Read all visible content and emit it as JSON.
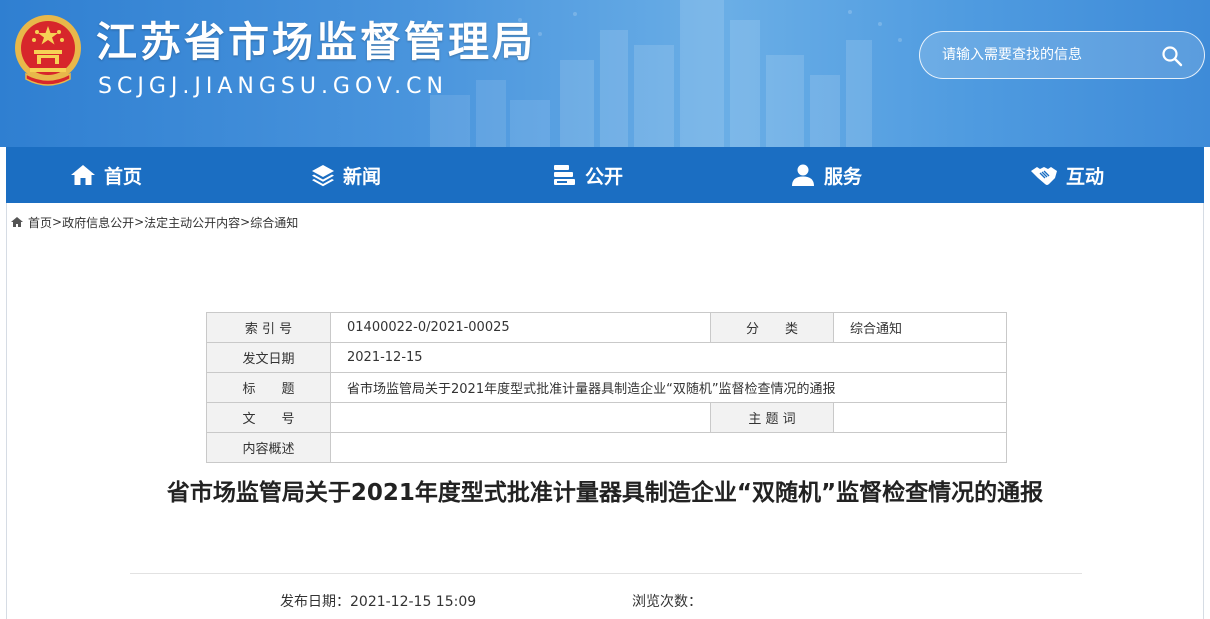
{
  "header": {
    "site_title": "江苏省市场监督管理局",
    "site_domain": "SCJGJ.JIANGSU.GOV.CN",
    "search_placeholder": "请输入需要查找的信息"
  },
  "nav": {
    "items": [
      {
        "label": "首页",
        "icon": "home-icon"
      },
      {
        "label": "新闻",
        "icon": "layers-icon"
      },
      {
        "label": "公开",
        "icon": "files-icon"
      },
      {
        "label": "服务",
        "icon": "user-icon"
      },
      {
        "label": "互动",
        "icon": "handshake-icon"
      }
    ]
  },
  "breadcrumb": {
    "items": [
      "首页",
      "政府信息公开",
      "法定主动公开内容",
      "综合通知"
    ],
    "separator": ">"
  },
  "info": {
    "index_label": "索 引 号",
    "index_value": "01400022-0/2021-00025",
    "category_label": "分　　类",
    "category_value": "综合通知",
    "date_label": "发文日期",
    "date_value": "2021-12-15",
    "title_label": "标　　题",
    "title_value": "省市场监管局关于2021年度型式批准计量器具制造企业“双随机”监督检查情况的通报",
    "docno_label": "文　　号",
    "docno_value": "",
    "subject_label": "主 题 词",
    "subject_value": "",
    "summary_label": "内容概述",
    "summary_value": ""
  },
  "article": {
    "title": "省市场监管局关于2021年度型式批准计量器具制造企业“双随机”监督检查情况的通报",
    "publish_label": "发布日期：",
    "publish_value": "2021-12-15 15:09",
    "views_label": "浏览次数："
  },
  "colors": {
    "header_blue": "#3e8bd8",
    "nav_blue": "#1b6ec2",
    "label_bg": "#f2f2f2"
  }
}
